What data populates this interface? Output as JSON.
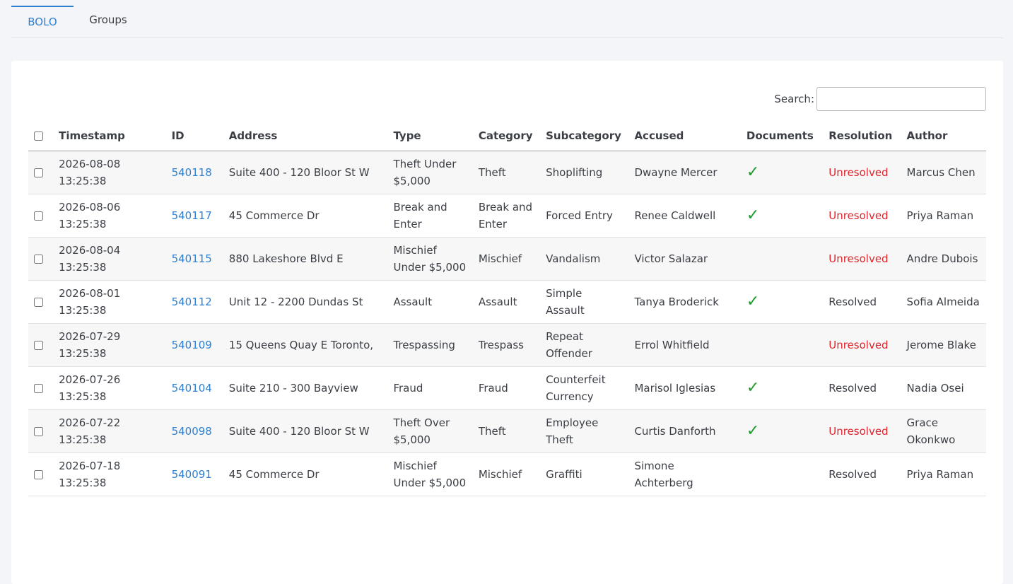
{
  "tabs": [
    {
      "label": "BOLO",
      "active": true
    },
    {
      "label": "Groups",
      "active": false
    }
  ],
  "search": {
    "label": "Search:",
    "value": "",
    "placeholder": ""
  },
  "table": {
    "columns": [
      "Timestamp",
      "ID",
      "Address",
      "Type",
      "Category",
      "Subcategory",
      "Accused",
      "Documents",
      "Resolution",
      "Author"
    ],
    "rows": [
      {
        "timestamp": "2026-08-08 13:25:38",
        "id": "540118",
        "address": "Suite 400 - 120 Bloor St W",
        "type": "Theft Under $5,000",
        "category": "Theft",
        "subcategory": "Shoplifting",
        "accused": "Dwayne Mercer",
        "documents": "✓",
        "resolution": "Unresolved",
        "author": "Marcus Chen"
      },
      {
        "timestamp": "2026-08-06 13:25:38",
        "id": "540117",
        "address": "45 Commerce Dr",
        "type": "Break and Enter",
        "category": "Break and Enter",
        "subcategory": "Forced Entry",
        "accused": "Renee Caldwell",
        "documents": "✓",
        "resolution": "Unresolved",
        "author": "Priya Raman"
      },
      {
        "timestamp": "2026-08-04 13:25:38",
        "id": "540115",
        "address": "880 Lakeshore Blvd E",
        "type": "Mischief Under $5,000",
        "category": "Mischief",
        "subcategory": "Vandalism",
        "accused": "Victor Salazar",
        "documents": "",
        "resolution": "Unresolved",
        "author": "Andre Dubois"
      },
      {
        "timestamp": "2026-08-01 13:25:38",
        "id": "540112",
        "address": "Unit 12 - 2200 Dundas St",
        "type": "Assault",
        "category": "Assault",
        "subcategory": "Simple Assault",
        "accused": "Tanya Broderick",
        "documents": "✓",
        "resolution": "Resolved",
        "author": "Sofia Almeida"
      },
      {
        "timestamp": "2026-07-29 13:25:38",
        "id": "540109",
        "address": "15 Queens Quay E Toronto,",
        "type": "Trespassing",
        "category": "Trespass",
        "subcategory": "Repeat Offender",
        "accused": "Errol Whitfield",
        "documents": "",
        "resolution": "Unresolved",
        "author": "Jerome Blake"
      },
      {
        "timestamp": "2026-07-26 13:25:38",
        "id": "540104",
        "address": "Suite 210 - 300 Bayview",
        "type": "Fraud",
        "category": "Fraud",
        "subcategory": "Counterfeit Currency",
        "accused": "Marisol Iglesias",
        "documents": "✓",
        "resolution": "Resolved",
        "author": "Nadia Osei"
      },
      {
        "timestamp": "2026-07-22 13:25:38",
        "id": "540098",
        "address": "Suite 400 - 120 Bloor St W",
        "type": "Theft Over $5,000",
        "category": "Theft",
        "subcategory": "Employee Theft",
        "accused": "Curtis Danforth",
        "documents": "✓",
        "resolution": "Unresolved",
        "author": "Grace Okonkwo"
      },
      {
        "timestamp": "2026-07-18 13:25:38",
        "id": "540091",
        "address": "45 Commerce Dr",
        "type": "Mischief Under $5,000",
        "category": "Mischief",
        "subcategory": "Graffiti",
        "accused": "Simone Achterberg",
        "documents": "",
        "resolution": "Resolved",
        "author": "Priya Raman"
      }
    ]
  },
  "colors": {
    "accent": "#2f7fd0",
    "unresolved": "#e0242c",
    "check": "#1f9b2e"
  }
}
